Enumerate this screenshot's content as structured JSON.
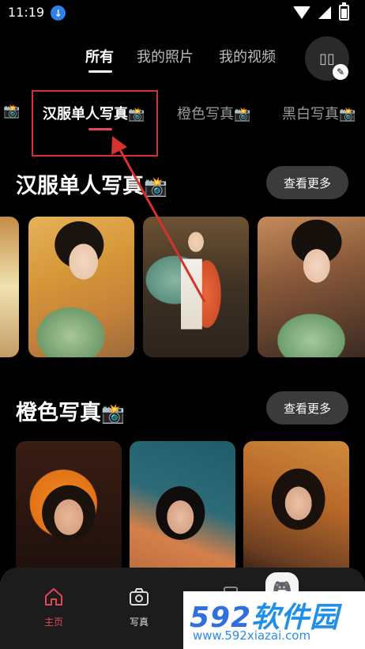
{
  "status_bar": {
    "time": "11:19",
    "download_badge": "↓"
  },
  "top_tabs": [
    {
      "label": "所有",
      "active": true
    },
    {
      "label": "我的照片",
      "active": false
    },
    {
      "label": "我的视频",
      "active": false
    }
  ],
  "top_action": {
    "placeholder_glyphs": "⃞⃞"
  },
  "category_tabs": [
    {
      "label": "",
      "emoji": "📸"
    },
    {
      "label": "汉服单人写真",
      "emoji": "📸",
      "active": true
    },
    {
      "label": "橙色写真",
      "emoji": "📸"
    },
    {
      "label": "黑白写真",
      "emoji": "📸"
    }
  ],
  "sections": [
    {
      "title": "汉服单人写真",
      "emoji": "📸",
      "more_label": "查看更多"
    },
    {
      "title": "橙色写真",
      "emoji": "📸",
      "more_label": "查看更多"
    }
  ],
  "bottom_nav": [
    {
      "label": "主页",
      "icon": "home-icon",
      "active": true
    },
    {
      "label": "写真",
      "icon": "camera-icon",
      "active": false
    }
  ],
  "watermark": {
    "main": "592软件园",
    "num": "592",
    "soft": "软件园",
    "url": "www.592xiazai.com"
  },
  "colors": {
    "accent": "#e0485a",
    "highlight_box": "#d6312f",
    "watermark_blue": "#2f6fe0"
  }
}
